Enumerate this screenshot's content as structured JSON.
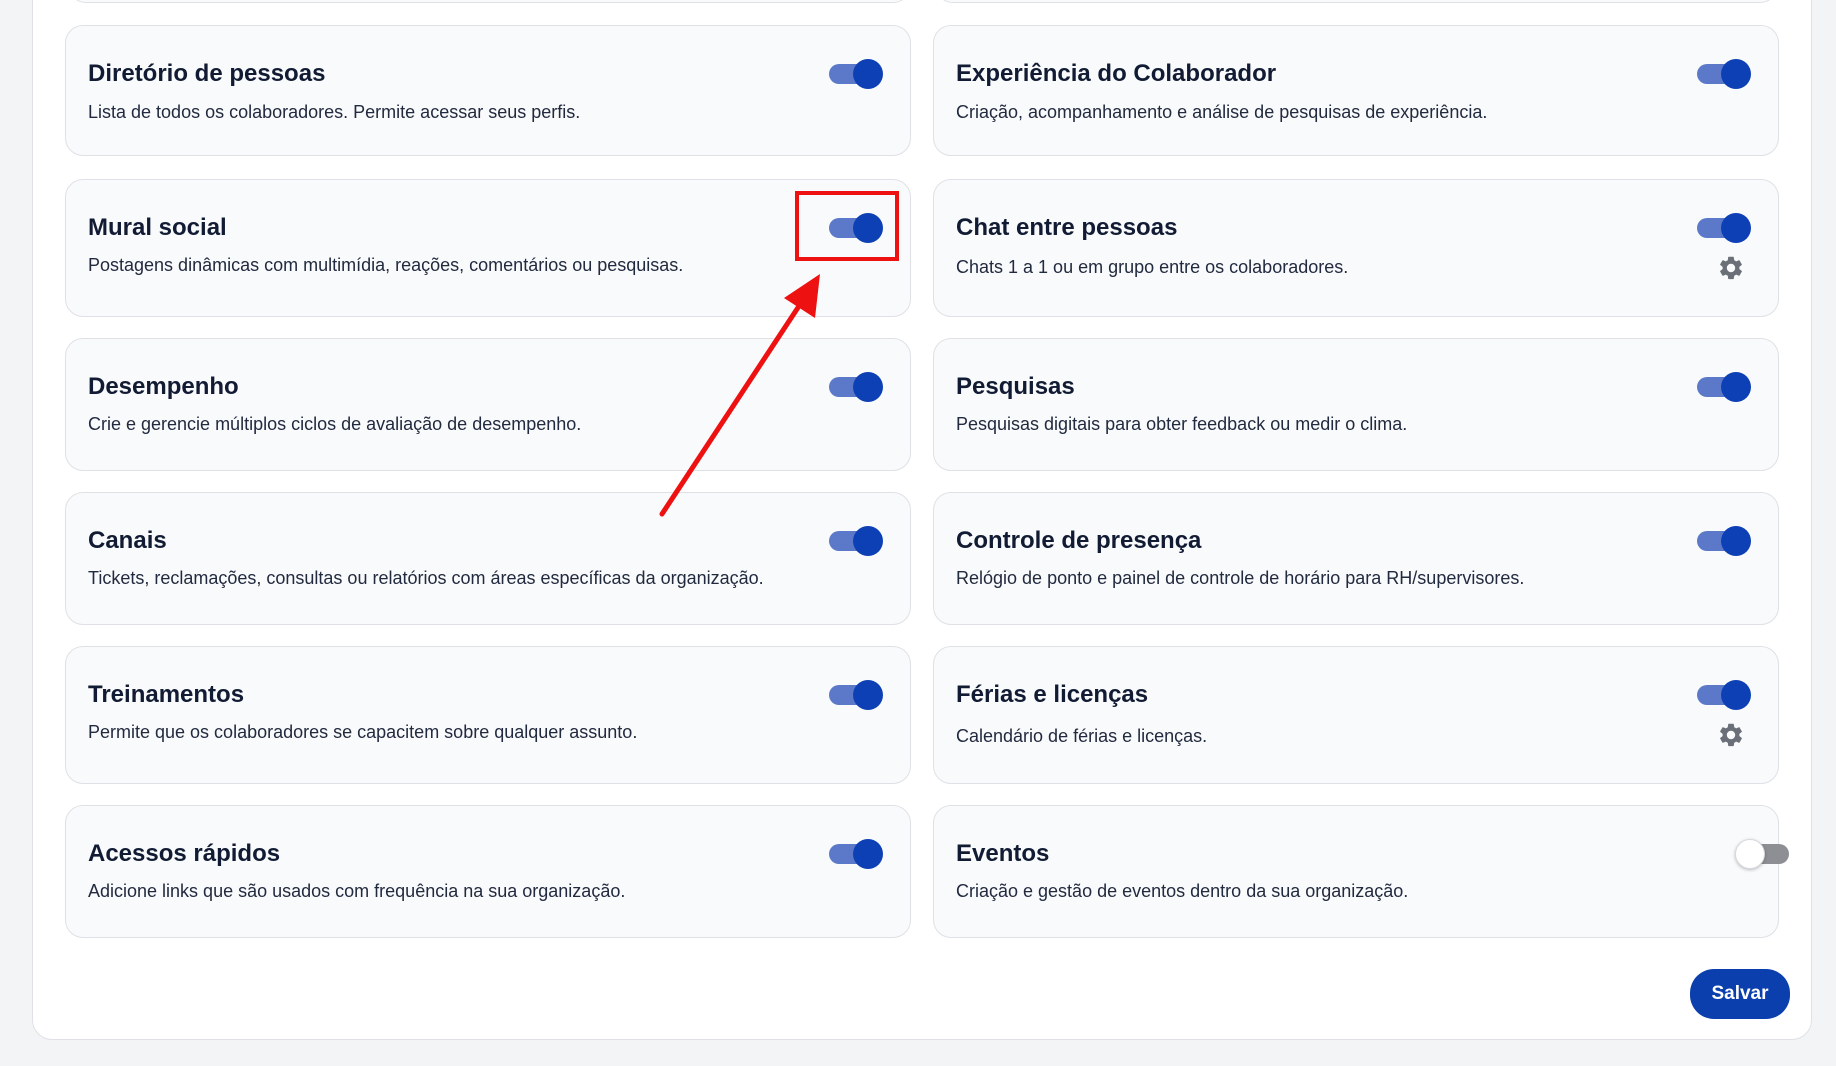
{
  "colors": {
    "toggle_on_track": "#5b79c8",
    "toggle_on_knob": "#0e40b5",
    "toggle_off_track": "#8d8f94",
    "primary_button": "#0b3fae",
    "annotation_red": "#ee1111"
  },
  "modules": [
    {
      "title": "Diretório de pessoas",
      "description": "Lista de todos os colaboradores. Permite acessar seus perfis.",
      "enabled": true
    },
    {
      "title": "Experiência do Colaborador",
      "description": "Criação, acompanhamento e análise de pesquisas de experiência.",
      "enabled": true
    },
    {
      "title": "Mural social",
      "description": "Postagens dinâmicas com multimídia, reações, comentários ou pesquisas.",
      "enabled": true,
      "highlighted": true
    },
    {
      "title": "Chat entre pessoas",
      "description": "Chats 1 a 1 ou em grupo entre os colaboradores.",
      "enabled": true,
      "has_settings": true,
      "settings_icon": "gear-icon"
    },
    {
      "title": "Desempenho",
      "description": "Crie e gerencie múltiplos ciclos de avaliação de desempenho.",
      "enabled": true
    },
    {
      "title": "Pesquisas",
      "description": "Pesquisas digitais para obter feedback ou medir o clima.",
      "enabled": true
    },
    {
      "title": "Canais",
      "description": "Tickets, reclamações, consultas ou relatórios com áreas específicas da organização.",
      "enabled": true
    },
    {
      "title": "Controle de presença",
      "description": "Relógio de ponto e painel de controle de horário para RH/supervisores.",
      "enabled": true
    },
    {
      "title": "Treinamentos",
      "description": "Permite que os colaboradores se capacitem sobre qualquer assunto.",
      "enabled": true
    },
    {
      "title": "Férias e licenças",
      "description": "Calendário de férias e licenças.",
      "enabled": true,
      "has_settings": true,
      "settings_icon": "gear-icon"
    },
    {
      "title": "Acessos rápidos",
      "description": "Adicione links que são usados com frequência na sua organização.",
      "enabled": true
    },
    {
      "title": "Eventos",
      "description": "Criação e gestão de eventos dentro da sua organização.",
      "enabled": false
    }
  ],
  "save_label": "Salvar",
  "annotation": {
    "type": "highlight-box-with-arrow",
    "target": "Mural social toggle"
  }
}
